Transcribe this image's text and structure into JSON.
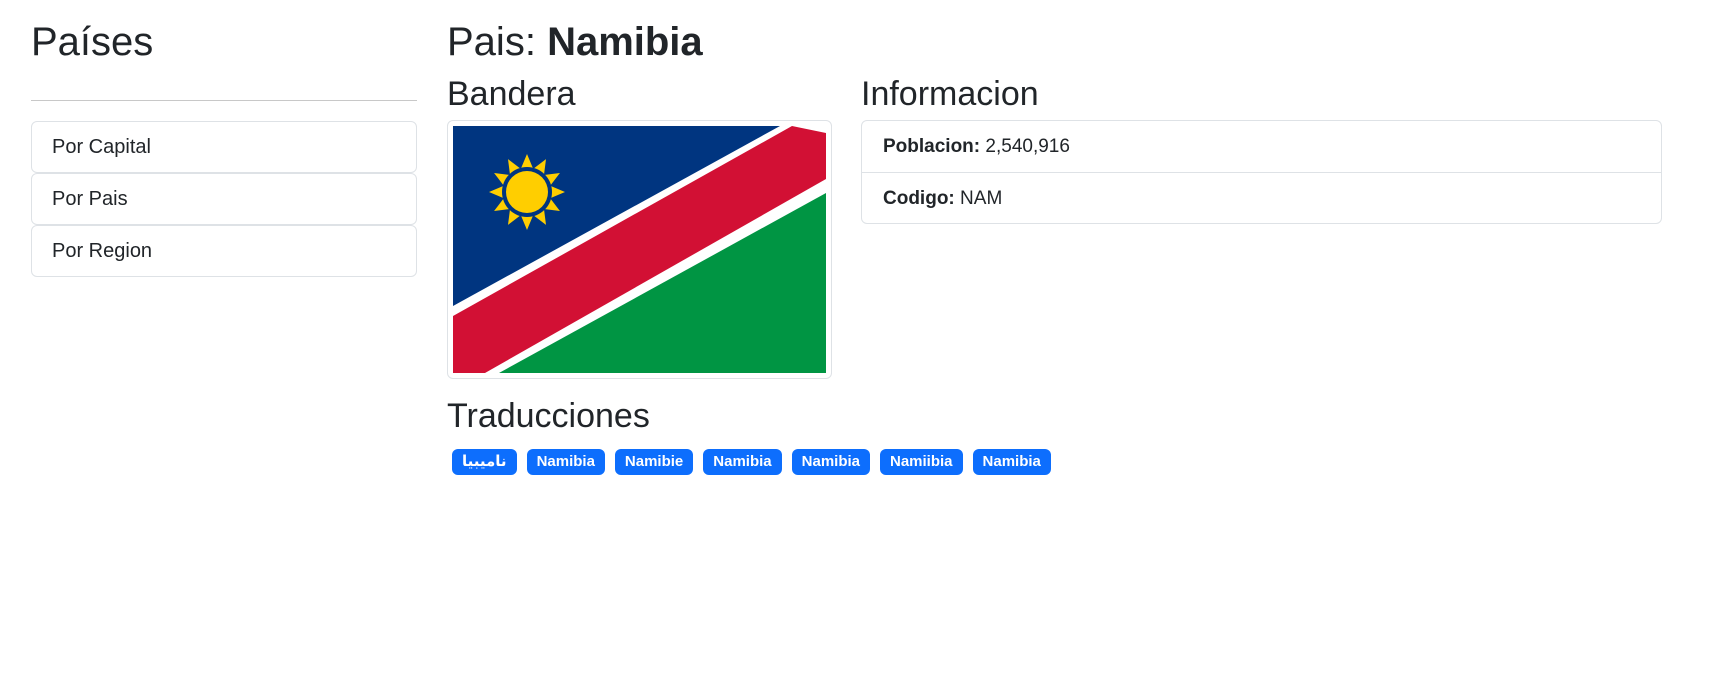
{
  "sidebar": {
    "title": "Países",
    "items": [
      {
        "label": "Por Capital"
      },
      {
        "label": "Por Pais"
      },
      {
        "label": "Por Region"
      }
    ]
  },
  "main": {
    "title_prefix": "Pais:",
    "country_name": "Namibia",
    "flag": {
      "heading": "Bandera",
      "colors": {
        "blue": "#003580",
        "red": "#D21034",
        "green": "#009543",
        "white": "#FFFFFF",
        "sun": "#FFCE00"
      }
    },
    "info": {
      "heading": "Informacion",
      "population_label": "Poblacion:",
      "population_value": "2,540,916",
      "code_label": "Codigo:",
      "code_value": "NAM"
    },
    "translations": {
      "heading": "Traducciones",
      "items": [
        "ناميبيا",
        "Namibia",
        "Namibie",
        "Namibia",
        "Namibia",
        "Namiibia",
        "Namibia"
      ],
      "badge_color": "#0D6EFD"
    }
  }
}
